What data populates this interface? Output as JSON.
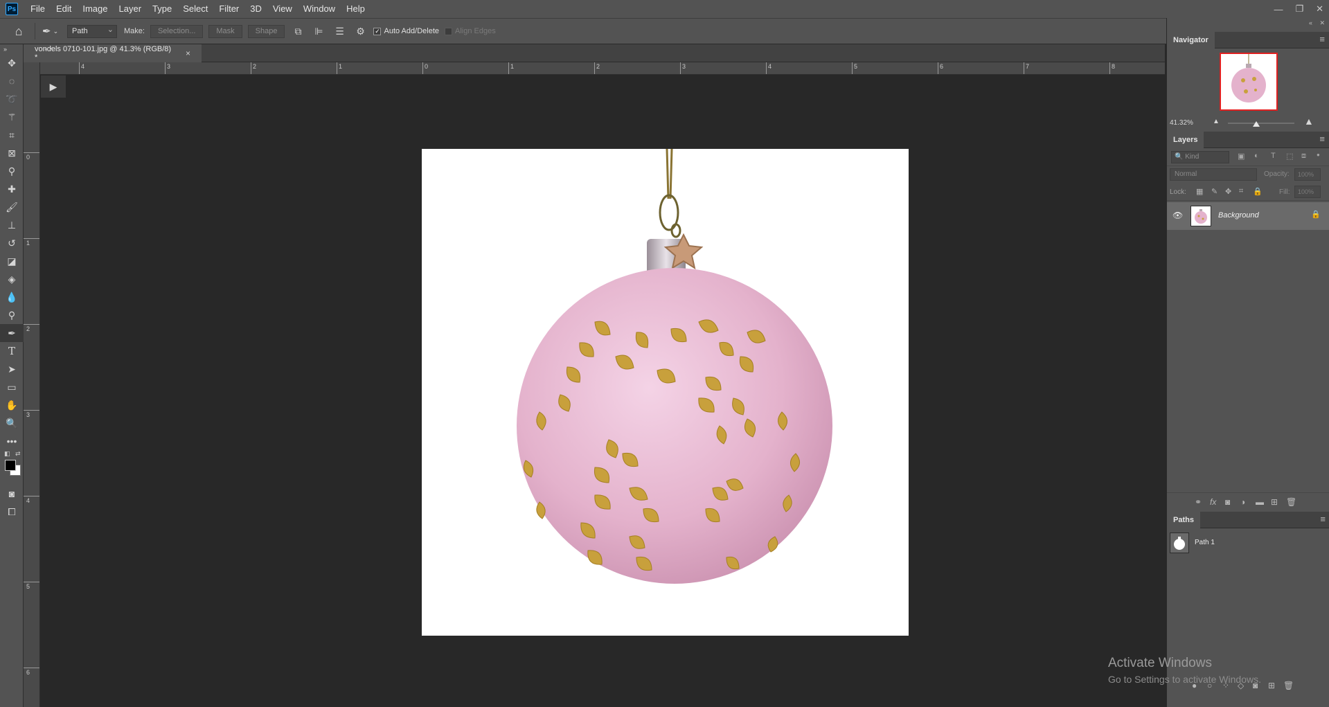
{
  "app": {
    "logo": "Ps",
    "menu": [
      "File",
      "Edit",
      "Image",
      "Layer",
      "Type",
      "Select",
      "Filter",
      "3D",
      "View",
      "Window",
      "Help"
    ],
    "window_controls": [
      "minimize-icon",
      "restore-icon",
      "close-icon"
    ]
  },
  "options_bar": {
    "mode_value": "Path",
    "make_label": "Make:",
    "selection_label": "Selection...",
    "mask_label": "Mask",
    "shape_label": "Shape",
    "auto_add_delete_label": "Auto Add/Delete",
    "auto_add_delete_checked": true,
    "align_edges_label": "Align Edges",
    "align_edges_checked": false
  },
  "document": {
    "tab_title": "vondels 0710-101.jpg @ 41.3% (RGB/8) *",
    "ruler_top": [
      "4",
      "3",
      "2",
      "1",
      "0",
      "1",
      "2",
      "3",
      "4",
      "5",
      "6",
      "7",
      "8"
    ],
    "ruler_left": [
      "0",
      "1",
      "2",
      "3",
      "4",
      "5",
      "6"
    ]
  },
  "navigator": {
    "title": "Navigator",
    "zoom": "41.32%"
  },
  "layers": {
    "title": "Layers",
    "kind_placeholder": "Kind",
    "blend_mode": "Normal",
    "opacity_label": "Opacity:",
    "opacity_value": "100%",
    "lock_label": "Lock:",
    "fill_label": "Fill:",
    "fill_value": "100%",
    "items": [
      {
        "name": "Background",
        "visible": true,
        "locked": true
      }
    ]
  },
  "paths": {
    "title": "Paths",
    "items": [
      {
        "name": "Path 1"
      }
    ]
  },
  "watermark": {
    "line1": "Activate Windows",
    "line2": "Go to Settings to activate Windows."
  },
  "colors": {
    "ornament_pink": "#e8bcd6",
    "gold_leaf": "#c8a03c",
    "foreground": "#000000",
    "background": "#ffffff"
  }
}
